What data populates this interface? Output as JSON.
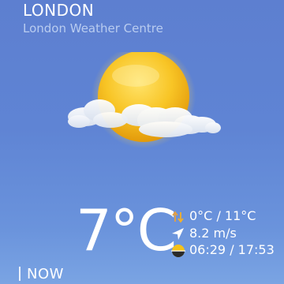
{
  "location": {
    "city": "LONDON",
    "station": "London Weather Centre"
  },
  "condition": {
    "icon": "sun-with-clouds-icon",
    "temperature": "7°C"
  },
  "details": {
    "min_max": "0°C / 11°C",
    "wind": "8.2 m/s",
    "sun_times": "06:29 / 17:53"
  },
  "period": {
    "label": "NOW"
  },
  "colors": {
    "sun": "#f5b418",
    "arrow_up": "#e6a040",
    "arrow_down": "#f2b02a"
  }
}
